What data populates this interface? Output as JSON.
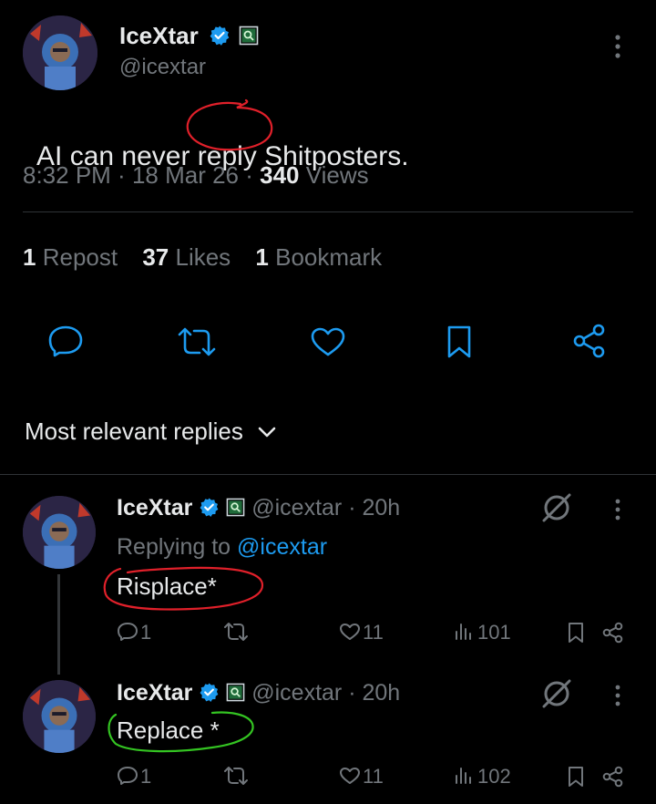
{
  "tweet": {
    "display_name": "IceXtar",
    "handle": "@icextar",
    "text_before": "AI can never ",
    "text_highlight": "reply",
    "text_after": " Shitposters.",
    "time": "8:32 PM",
    "date": "18 Mar 26",
    "views_count": "340",
    "views_label": "Views",
    "reposts_count": "1",
    "reposts_label": "Repost",
    "likes_count": "37",
    "likes_label": "Likes",
    "bookmarks_count": "1",
    "bookmarks_label": "Bookmark"
  },
  "sort": {
    "label": "Most relevant replies"
  },
  "replies": [
    {
      "display_name": "IceXtar",
      "handle": "@icextar",
      "age": "20h",
      "replying_prefix": "Replying to",
      "replying_handle": "@icextar",
      "text": "Risplace*",
      "reply_count": "1",
      "like_count": "11",
      "view_count": "101"
    },
    {
      "display_name": "IceXtar",
      "handle": "@icextar",
      "age": "20h",
      "text": "Replace *",
      "reply_count": "1",
      "like_count": "11",
      "view_count": "102"
    }
  ],
  "colors": {
    "accent": "#1d9bf0",
    "muted": "#71767b",
    "annotation_red": "#e0202a",
    "annotation_green": "#34c422"
  },
  "icons": [
    "more-icon",
    "verified-icon",
    "reply-icon",
    "repost-icon",
    "like-icon",
    "bookmark-icon",
    "share-icon",
    "grok-icon",
    "views-icon",
    "chevron-down-icon"
  ]
}
